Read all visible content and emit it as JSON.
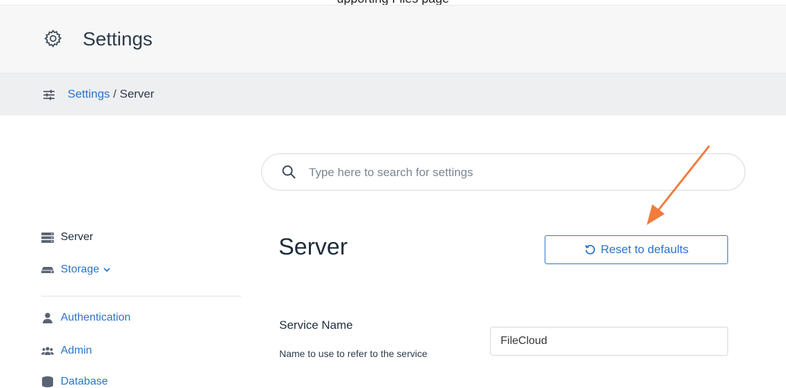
{
  "top_banner": {
    "text": "upporting Files page"
  },
  "header": {
    "title": "Settings",
    "icon": "gear-icon"
  },
  "breadcrumb": {
    "link": "Settings",
    "separator": "/",
    "current": "Server",
    "icon": "sliders-icon"
  },
  "search": {
    "placeholder": "Type here to search for settings",
    "value": ""
  },
  "sidebar": {
    "items": [
      {
        "label": "Server",
        "icon": "server-icon",
        "active": true
      },
      {
        "label": "Storage",
        "icon": "storage-icon",
        "dropdown": "chevron-down-icon"
      },
      {
        "label": "Authentication",
        "icon": "user-icon"
      },
      {
        "label": "Admin",
        "icon": "users-icon"
      },
      {
        "label": "Database",
        "icon": "database-icon"
      }
    ]
  },
  "main": {
    "title": "Server",
    "reset_button": "Reset to defaults",
    "fields": [
      {
        "label": "Service Name",
        "help": "Name to use to refer to the service",
        "value": "FileCloud"
      }
    ]
  },
  "colors": {
    "accent": "#2a74c9",
    "annotation_arrow": "#f07c3d",
    "text": "#1e2b3a"
  }
}
